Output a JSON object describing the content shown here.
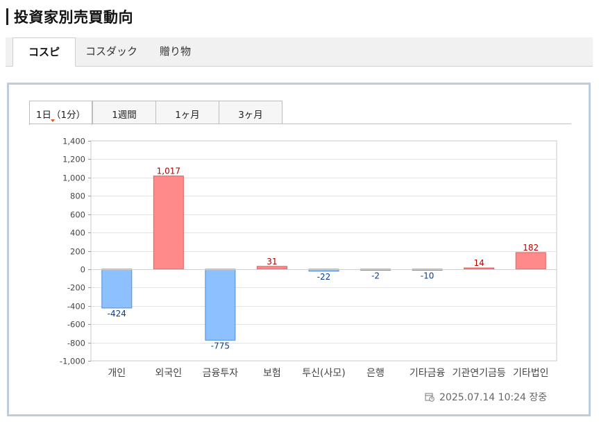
{
  "page": {
    "title": "投資家別売買動向"
  },
  "market_tabs": [
    {
      "label": "コスピ",
      "active": true
    },
    {
      "label": "コスダック",
      "active": false
    },
    {
      "label": "贈り物",
      "active": false
    }
  ],
  "period_tabs": [
    {
      "label": "1日（1分）",
      "active": true
    },
    {
      "label": "1週間",
      "active": false
    },
    {
      "label": "1ヶ月",
      "active": false
    },
    {
      "label": "3ヶ月",
      "active": false
    }
  ],
  "footer": {
    "timestamp": "2025.07.14 10:24 장중"
  },
  "colors": {
    "positive_fill": "#ff8a8a",
    "positive_stroke": "#e06060",
    "positive_label": "#b00000",
    "negative_fill": "#8cc0ff",
    "negative_stroke": "#4f8fd6",
    "negative_label": "#0a3c8a",
    "panel_border": "#bccde0"
  },
  "chart_data": {
    "type": "bar",
    "categories": [
      "개인",
      "외국인",
      "금융투자",
      "보험",
      "투신(사모)",
      "은행",
      "기타금융",
      "기관연기금등",
      "기타법인"
    ],
    "values": [
      -424,
      1017,
      -775,
      31,
      -22,
      -2,
      -10,
      14,
      182
    ],
    "value_labels": [
      "-424",
      "1,017",
      "-775",
      "31",
      "-22",
      "-2",
      "-10",
      "14",
      "182"
    ],
    "ylim": [
      -1000,
      1400
    ],
    "yticks": [
      1400,
      1200,
      1000,
      800,
      600,
      400,
      200,
      0,
      -200,
      -400,
      -600,
      -800,
      -1000
    ],
    "ytick_labels": [
      "1,400",
      "1,200",
      "1,000",
      "800",
      "600",
      "400",
      "200",
      "0",
      "-200",
      "-400",
      "-600",
      "-800",
      "-1,000"
    ],
    "grid": true,
    "legend": false
  }
}
